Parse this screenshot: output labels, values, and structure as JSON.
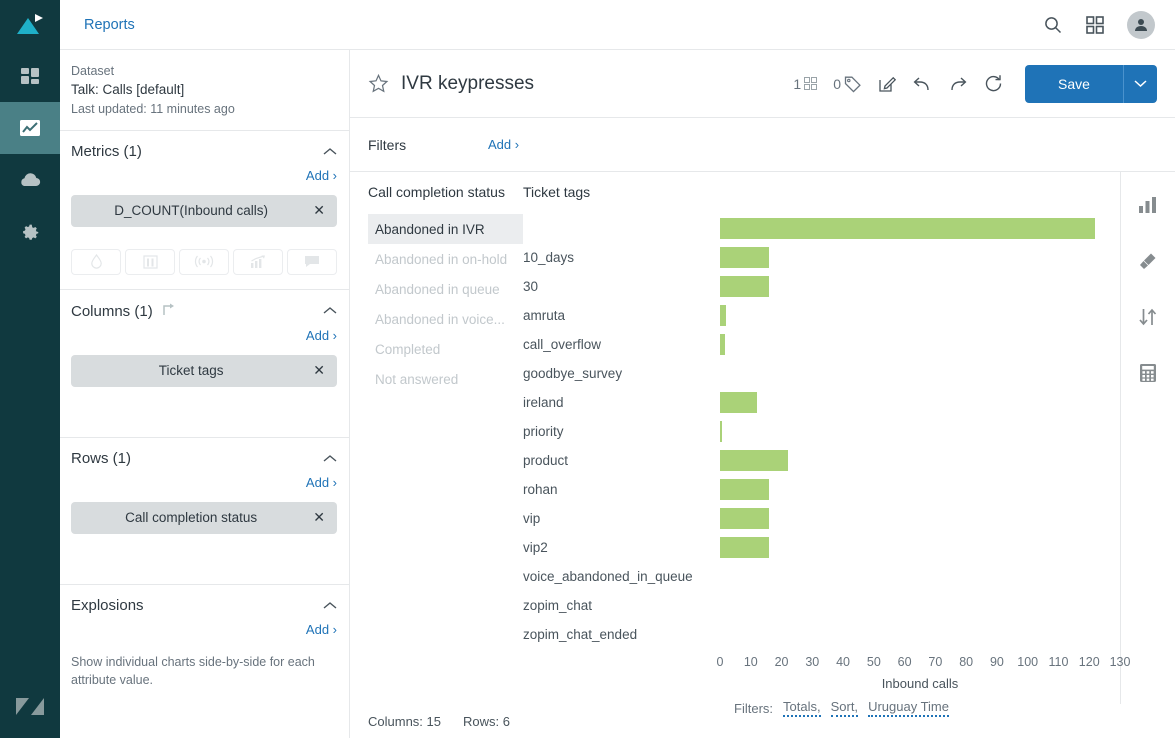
{
  "rail": {
    "items": [
      {
        "name": "explore-logo",
        "icon": "triangle-play-logo"
      },
      {
        "name": "dashboards",
        "icon": "dashboard-grid-icon",
        "active": false
      },
      {
        "name": "reports",
        "icon": "line-chart-icon",
        "active": true
      },
      {
        "name": "datasets",
        "icon": "cloud-upload-icon",
        "active": false
      },
      {
        "name": "admin",
        "icon": "gear-icon",
        "active": false
      }
    ],
    "bottom_icon": "zendesk-logo"
  },
  "topbar": {
    "title": "Reports",
    "search_icon": "search-icon",
    "apps_icon": "apps-grid-icon",
    "avatar_icon": "user-avatar-icon"
  },
  "panel": {
    "dataset": {
      "label": "Dataset",
      "value": "Talk: Calls [default]",
      "updated": "Last updated: 11 minutes ago"
    },
    "metrics": {
      "title": "Metrics (1)",
      "add": "Add ›",
      "chips": [
        {
          "label": "D_COUNT(Inbound calls)",
          "remove": "✕"
        }
      ],
      "tool_icons": [
        "droplet-icon",
        "column-chart-icon",
        "signal-icon",
        "trend-chart-icon",
        "comment-icon"
      ]
    },
    "columns": {
      "title": "Columns (1)",
      "swap_icon": "swap-rows-columns-icon",
      "add": "Add ›",
      "chips": [
        {
          "label": "Ticket tags",
          "remove": "✕"
        }
      ]
    },
    "rows": {
      "title": "Rows (1)",
      "add": "Add ›",
      "chips": [
        {
          "label": "Call completion status",
          "remove": "✕"
        }
      ]
    },
    "explosions": {
      "title": "Explosions",
      "add": "Add ›",
      "note": "Show individual charts side-by-side for each attribute value."
    }
  },
  "report": {
    "star_icon": "star-outline-icon",
    "title": "IVR keypresses",
    "dashboard_count": "1",
    "dashboard_icon": "dashboard-small-icon",
    "tag_count": "0",
    "tag_icon": "tag-icon",
    "tools": [
      {
        "name": "edit-description-button",
        "icon": "pencil-square-icon"
      },
      {
        "name": "undo-button",
        "icon": "undo-arrow-icon"
      },
      {
        "name": "redo-button",
        "icon": "redo-arrow-icon"
      },
      {
        "name": "refresh-button",
        "icon": "refresh-circle-icon"
      }
    ],
    "save_label": "Save",
    "save_caret_icon": "chevron-down-icon",
    "filters_label": "Filters",
    "filters_add": "Add ›",
    "accent_blue": "#1f73b7"
  },
  "rightrail": {
    "items": [
      {
        "name": "chart-type-button",
        "icon": "bar-chart-icon"
      },
      {
        "name": "chart-style-button",
        "icon": "paintbrush-icon"
      },
      {
        "name": "chart-sort-button",
        "icon": "sort-arrows-icon"
      },
      {
        "name": "calculations-button",
        "icon": "calculator-icon"
      }
    ]
  },
  "footer": {
    "filters_label": "Filters:",
    "links": [
      "Totals,",
      "Sort,",
      "Uruguay Time"
    ],
    "columns_count": "Columns: 15",
    "rows_count": "Rows: 6"
  },
  "chart_data": {
    "type": "bar",
    "orientation": "horizontal",
    "title": "",
    "xlabel": "Inbound calls",
    "ylabel": "Ticket tags",
    "row_header": "Call completion status",
    "col_header": "Ticket tags",
    "bar_color": "#aad278",
    "grid": false,
    "legend": "none",
    "xlim": [
      0,
      130
    ],
    "xticks": [
      0,
      10,
      20,
      30,
      40,
      50,
      60,
      70,
      80,
      90,
      100,
      110,
      120,
      130
    ],
    "row_categories": [
      {
        "label": "Abandoned in IVR",
        "selected": true
      },
      {
        "label": "Abandoned in on-hold",
        "selected": false
      },
      {
        "label": "Abandoned in queue",
        "selected": false
      },
      {
        "label": "Abandoned in voice...",
        "selected": false
      },
      {
        "label": "Completed",
        "selected": false
      },
      {
        "label": "Not answered",
        "selected": false
      }
    ],
    "categories": [
      "",
      "10_days",
      "30",
      "amruta",
      "call_overflow",
      "goodbye_survey",
      "ireland",
      "priority",
      "product",
      "rohan",
      "vip",
      "vip2",
      "voice_abandoned_in_queue",
      "zopim_chat",
      "zopim_chat_ended"
    ],
    "values": [
      122,
      16,
      16,
      2,
      1.5,
      0,
      12,
      0.5,
      22,
      16,
      16,
      16,
      0,
      0,
      0
    ]
  }
}
